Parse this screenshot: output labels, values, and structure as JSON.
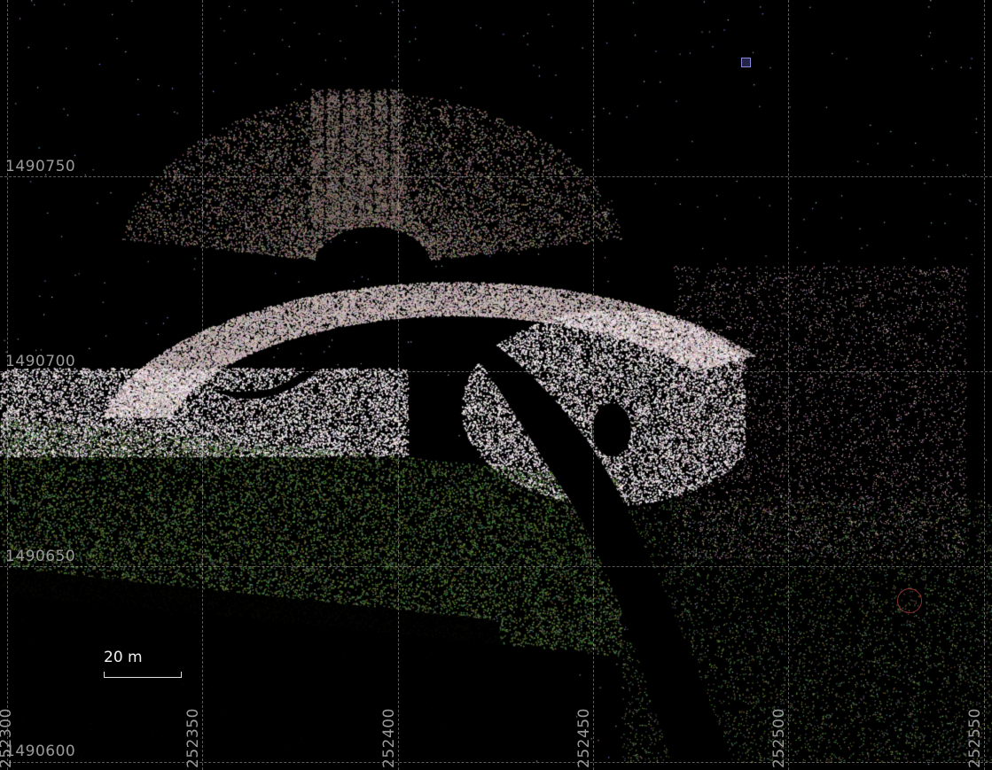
{
  "map": {
    "background": "#000000",
    "grid_color": "#c8c8c8",
    "x_ticks": [
      "252300",
      "252350",
      "252400",
      "252450",
      "252500",
      "252550"
    ],
    "y_ticks": [
      "1490750",
      "1490700",
      "1490650",
      "1490600"
    ],
    "scale_bar_label": "20 m"
  },
  "palette": {
    "sand_light": "#efe6ea",
    "sand_mid": "#c9b8b8",
    "mud": "#8a7a72",
    "vegetation": "#4f6b3a",
    "water": "#000000"
  }
}
